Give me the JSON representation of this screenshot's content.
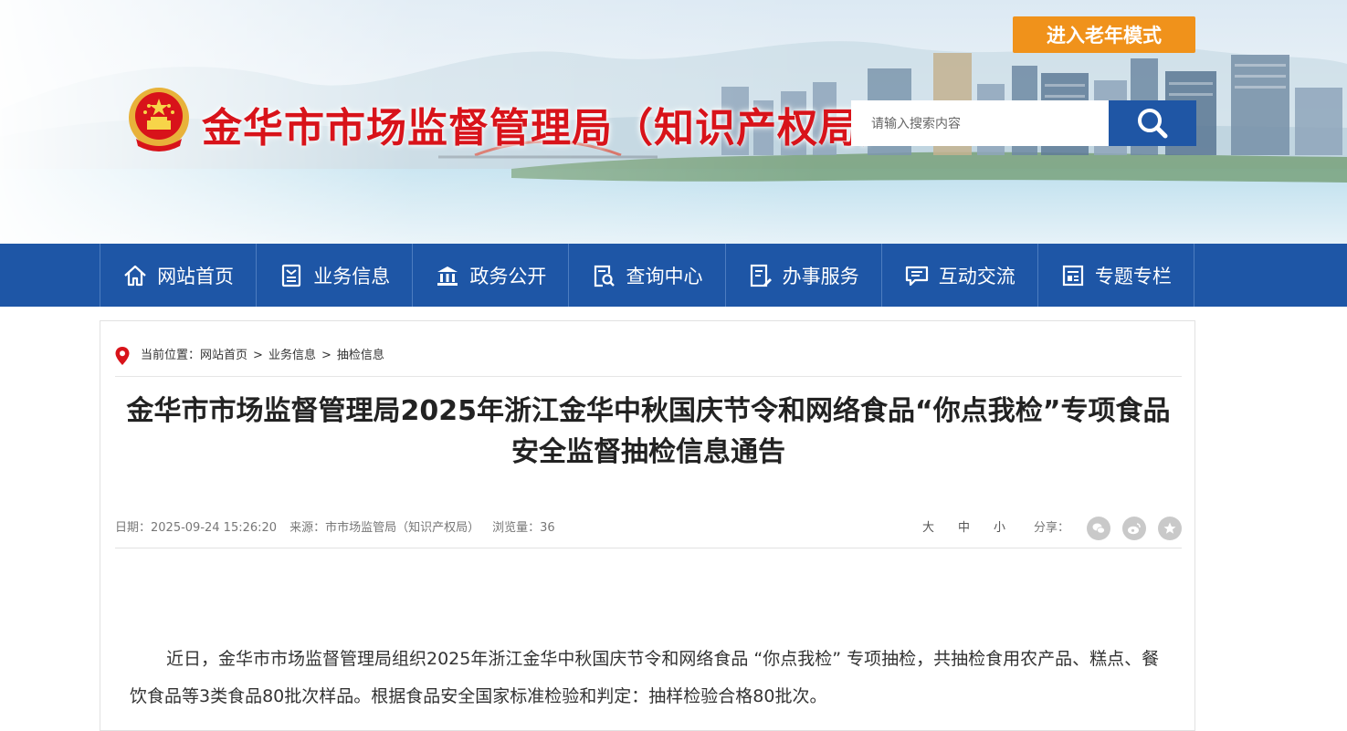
{
  "header": {
    "site_title": "金华市市场监督管理局（知识产权局）",
    "elder_mode_label": "进入老年模式",
    "search_placeholder": "请输入搜索内容"
  },
  "nav": {
    "items": [
      {
        "label": "网站首页",
        "icon": "home-icon"
      },
      {
        "label": "业务信息",
        "icon": "document-icon"
      },
      {
        "label": "政务公开",
        "icon": "government-building-icon"
      },
      {
        "label": "查询中心",
        "icon": "search-document-icon"
      },
      {
        "label": "办事服务",
        "icon": "form-edit-icon"
      },
      {
        "label": "互动交流",
        "icon": "chat-icon"
      },
      {
        "label": "专题专栏",
        "icon": "column-icon"
      }
    ]
  },
  "breadcrumb": {
    "prefix": "当前位置：",
    "items": [
      "网站首页",
      "业务信息",
      "抽检信息"
    ],
    "separator": ">"
  },
  "article": {
    "title": "金华市市场监督管理局2025年浙江金华中秋国庆节令和网络食品“你点我检”专项食品安全监督抽检信息通告",
    "date": "日期：2025-09-24 15:26:20",
    "source": "来源：市市场监管局（知识产权局）",
    "views": "浏览量：36",
    "font_sizes": [
      "大",
      "中",
      "小"
    ],
    "share_label": "分享：",
    "share_icons": [
      "wechat-icon",
      "weibo-icon",
      "star-icon"
    ],
    "body": "近日，金华市市场监督管理局组织2025年浙江金华中秋国庆节令和网络食品 “你点我检” 专项抽检，共抽检食用农产品、糕点、餐饮食品等3类食品80批次样品。根据食品安全国家标准检验和判定：抽样检验合格80批次。"
  },
  "colors": {
    "title_red": "#d8131a",
    "nav_blue": "#1e56a6",
    "elder_orange": "#f0921b"
  }
}
